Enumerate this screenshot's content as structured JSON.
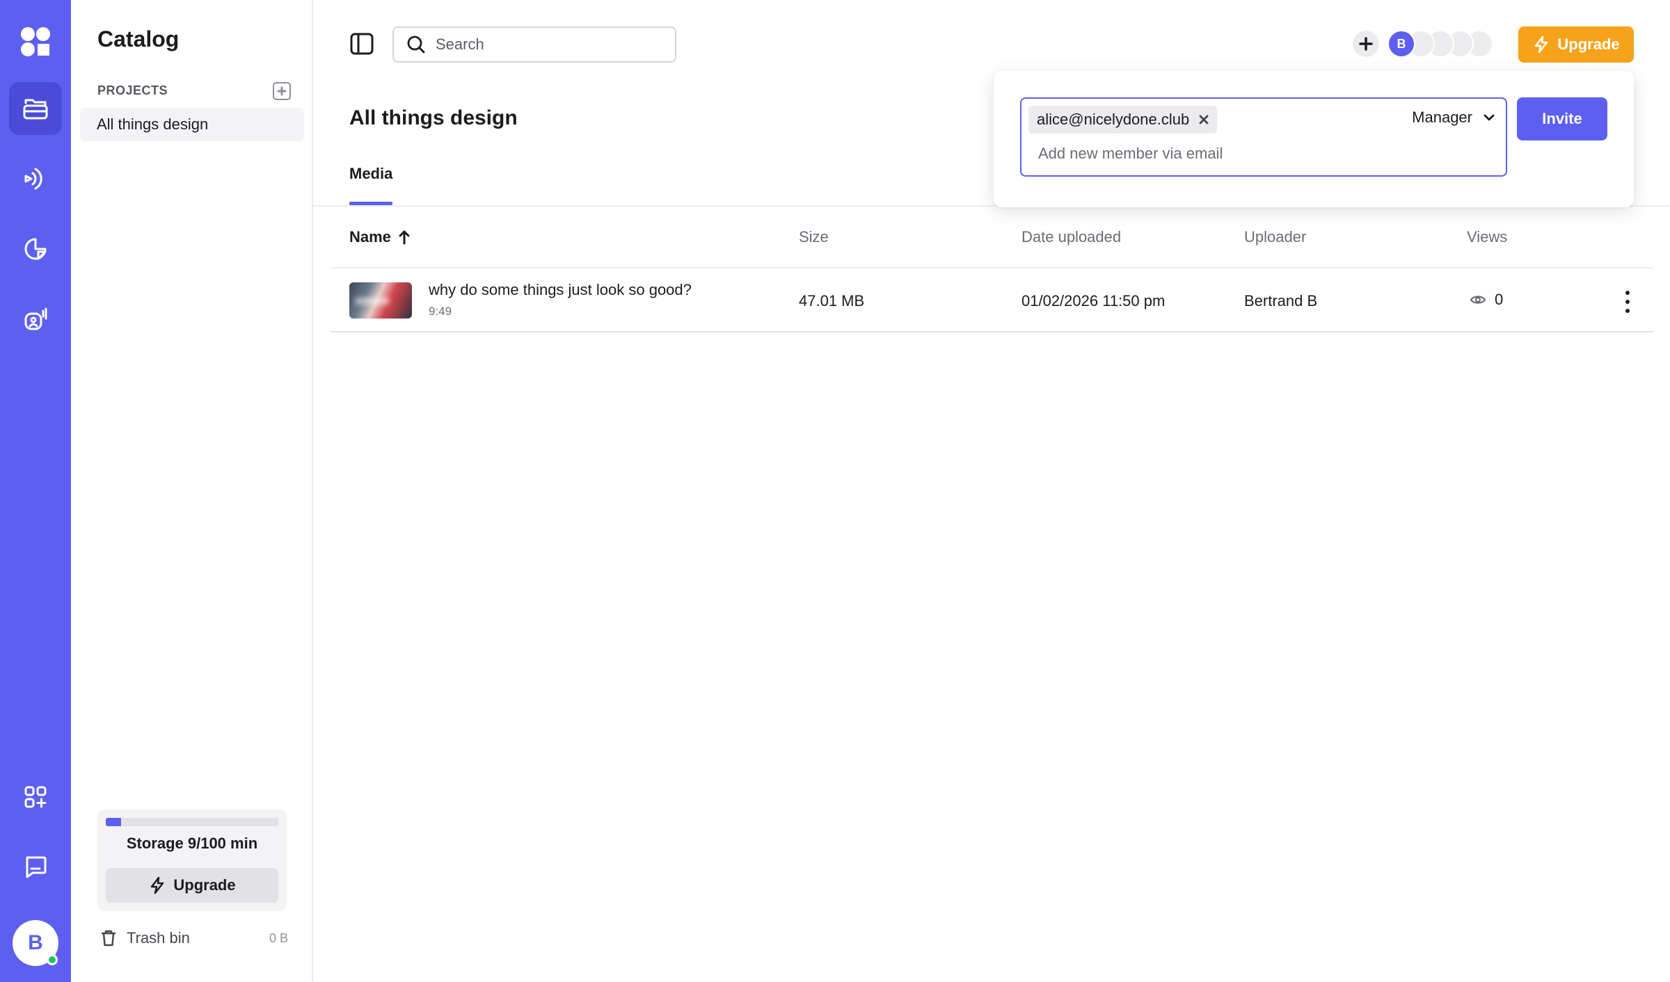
{
  "sidebar": {
    "title": "Catalog",
    "section_label": "PROJECTS",
    "projects": [
      {
        "label": "All things design"
      }
    ],
    "storage": {
      "text": "Storage 9/100 min",
      "used_fraction": 0.09,
      "upgrade_label": "Upgrade"
    },
    "trash": {
      "label": "Trash bin",
      "size": "0 B"
    }
  },
  "rail": {
    "avatar_initial": "B",
    "icons": [
      "logo-icon",
      "folder-icon",
      "broadcast-icon",
      "chart-icon",
      "ai-voice-icon",
      "apps-icon",
      "chat-icon"
    ]
  },
  "topbar": {
    "search_placeholder": "Search",
    "avatar_initial": "B",
    "upgrade_label": "Upgrade"
  },
  "main": {
    "title": "All things design",
    "tabs": [
      {
        "label": "Media",
        "active": true
      }
    ],
    "table": {
      "columns": [
        "Name",
        "Size",
        "Date uploaded",
        "Uploader",
        "Views"
      ],
      "rows": [
        {
          "title": "why do some things just look so good?",
          "duration": "9:49",
          "size": "47.01 MB",
          "date": "01/02/2026 11:50 pm",
          "uploader": "Bertrand B",
          "views": "0"
        }
      ]
    }
  },
  "invite": {
    "chip_email": "alice@nicelydone.club",
    "input_placeholder": "Add new member via email",
    "role": "Manager",
    "button_label": "Invite"
  },
  "colors": {
    "accent": "#5d5ff0",
    "upgrade": "#f5a31a"
  }
}
